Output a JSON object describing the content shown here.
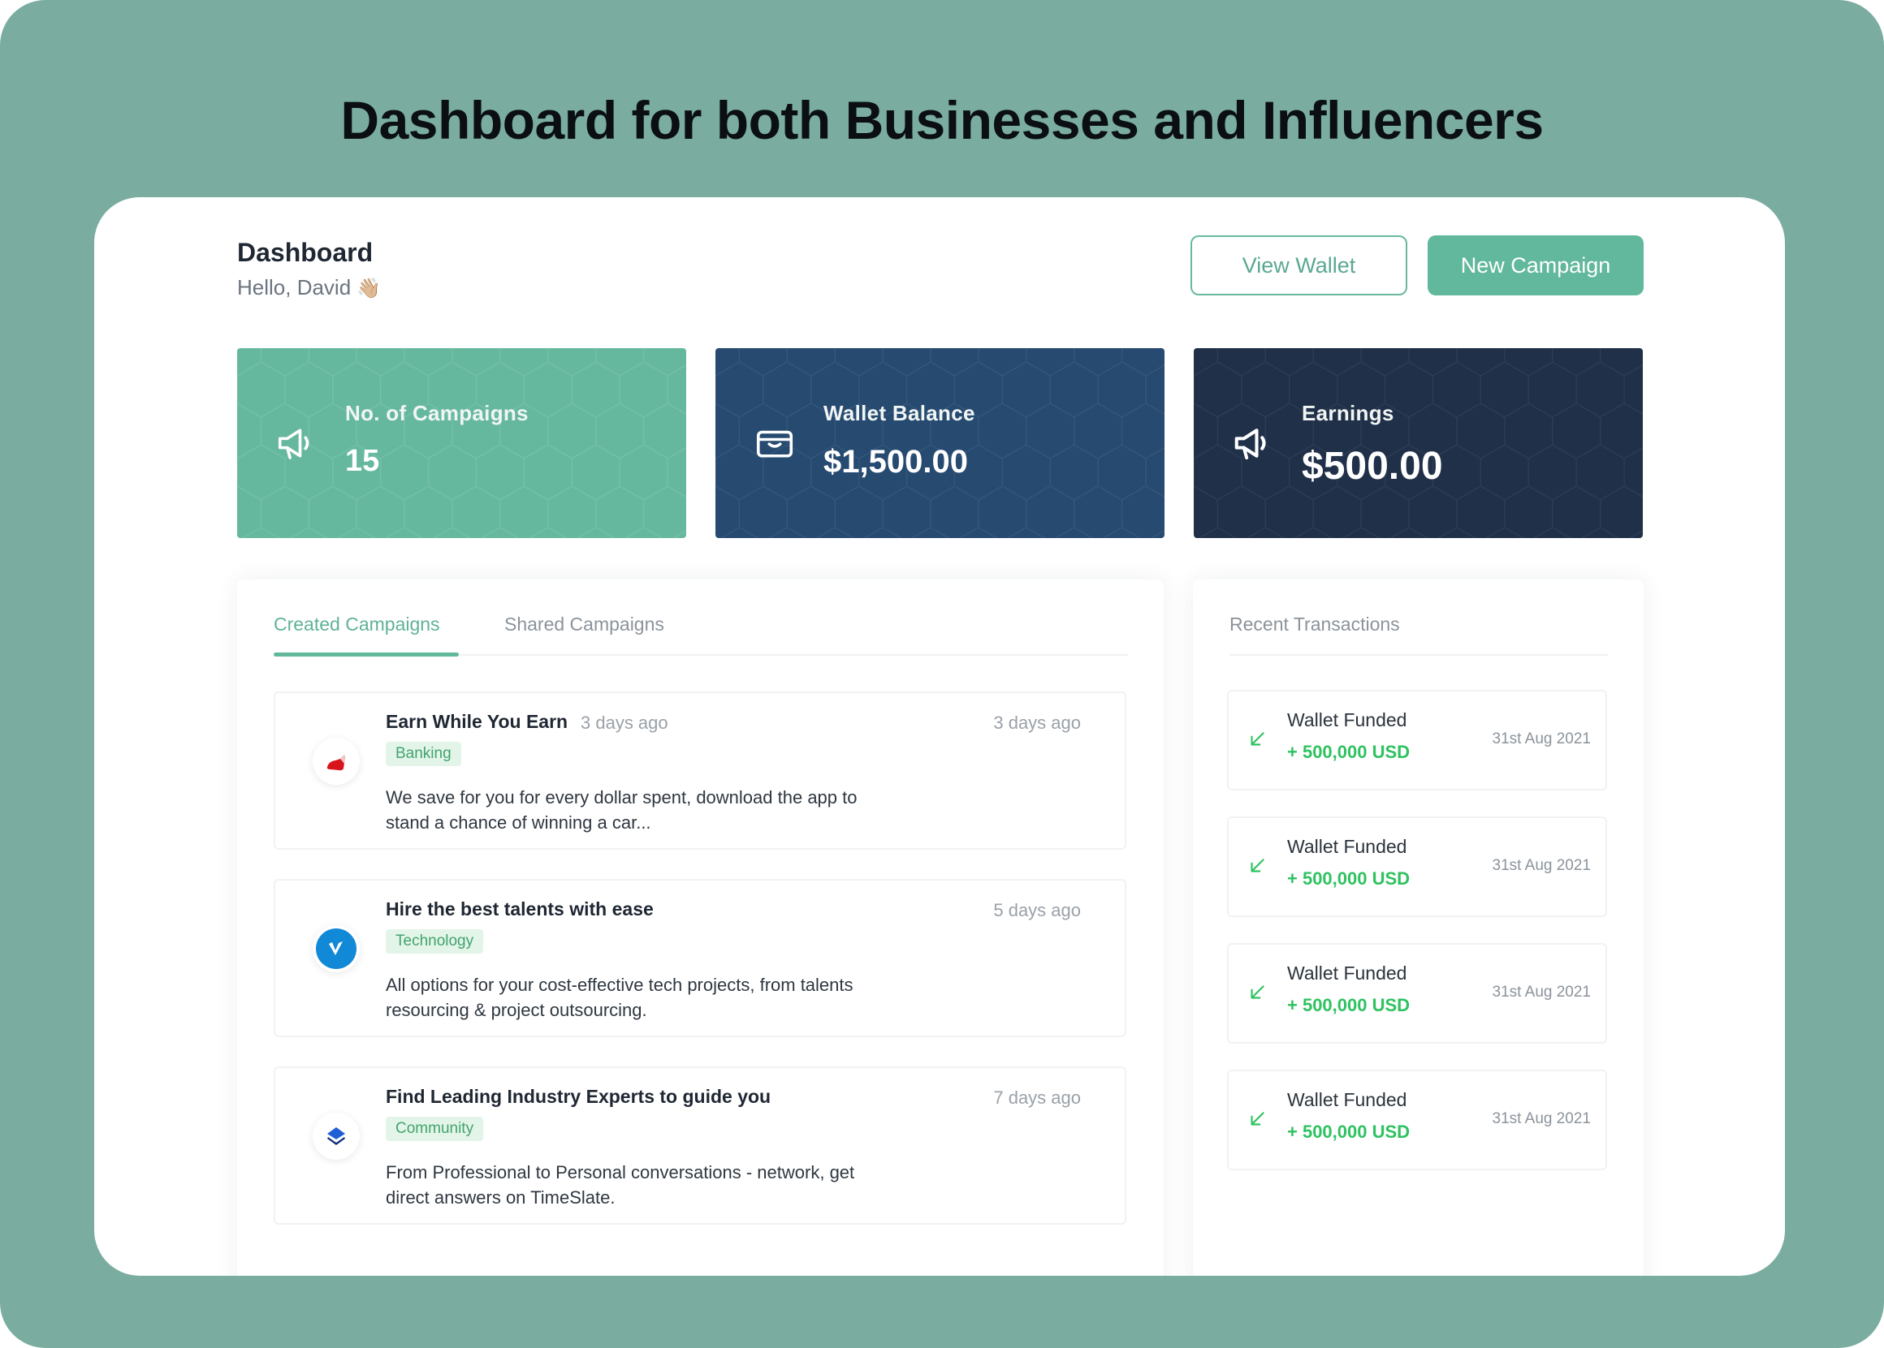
{
  "headline": "Dashboard for both Businesses and Influencers",
  "colors": {
    "background": "#7aada0",
    "accent": "#62b89c",
    "wallet_card": "#264a70",
    "earnings_card": "#203048",
    "amount_green": "#2ec260"
  },
  "header": {
    "title": "Dashboard",
    "greeting": "Hello, David",
    "greeting_emoji": "👋🏼"
  },
  "actions": {
    "view_wallet": "View Wallet",
    "new_campaign": "New Campaign"
  },
  "stats": [
    {
      "label": "No. of Campaigns",
      "value": "15",
      "icon": "megaphone-icon"
    },
    {
      "label": "Wallet Balance",
      "value": "$1,500.00",
      "icon": "wallet-icon"
    },
    {
      "label": "Earnings",
      "value": "$500.00",
      "icon": "megaphone-icon"
    }
  ],
  "campaigns": {
    "tabs": [
      "Created Campaigns",
      "Shared Campaigns"
    ],
    "active_tab": "Created Campaigns",
    "items": [
      {
        "title": "Earn While You Earn",
        "inline_time": "3 days ago",
        "time": "3 days ago",
        "tag": "Banking",
        "description": "We save for you for every dollar spent, download the app to stand a chance of winning a car...",
        "logo": "red-shape-logo"
      },
      {
        "title": "Hire the best talents with ease",
        "time": "5 days ago",
        "tag": "Technology",
        "description": "All options for your cost-effective tech projects, from talents resourcing & project outsourcing.",
        "logo": "blue-circle-logo"
      },
      {
        "title": "Find Leading Industry Experts to guide you",
        "time": "7 days ago",
        "tag": "Community",
        "description": "From Professional to Personal conversations - network, get direct answers on TimeSlate.",
        "logo": "layers-logo"
      }
    ]
  },
  "transactions": {
    "title": "Recent Transactions",
    "items": [
      {
        "title": "Wallet Funded",
        "amount": "+ 500,000 USD",
        "date": "31st Aug 2021"
      },
      {
        "title": "Wallet Funded",
        "amount": "+ 500,000 USD",
        "date": "31st Aug 2021"
      },
      {
        "title": "Wallet Funded",
        "amount": "+ 500,000 USD",
        "date": "31st Aug 2021"
      },
      {
        "title": "Wallet Funded",
        "amount": "+ 500,000 USD",
        "date": "31st Aug 2021"
      }
    ]
  }
}
